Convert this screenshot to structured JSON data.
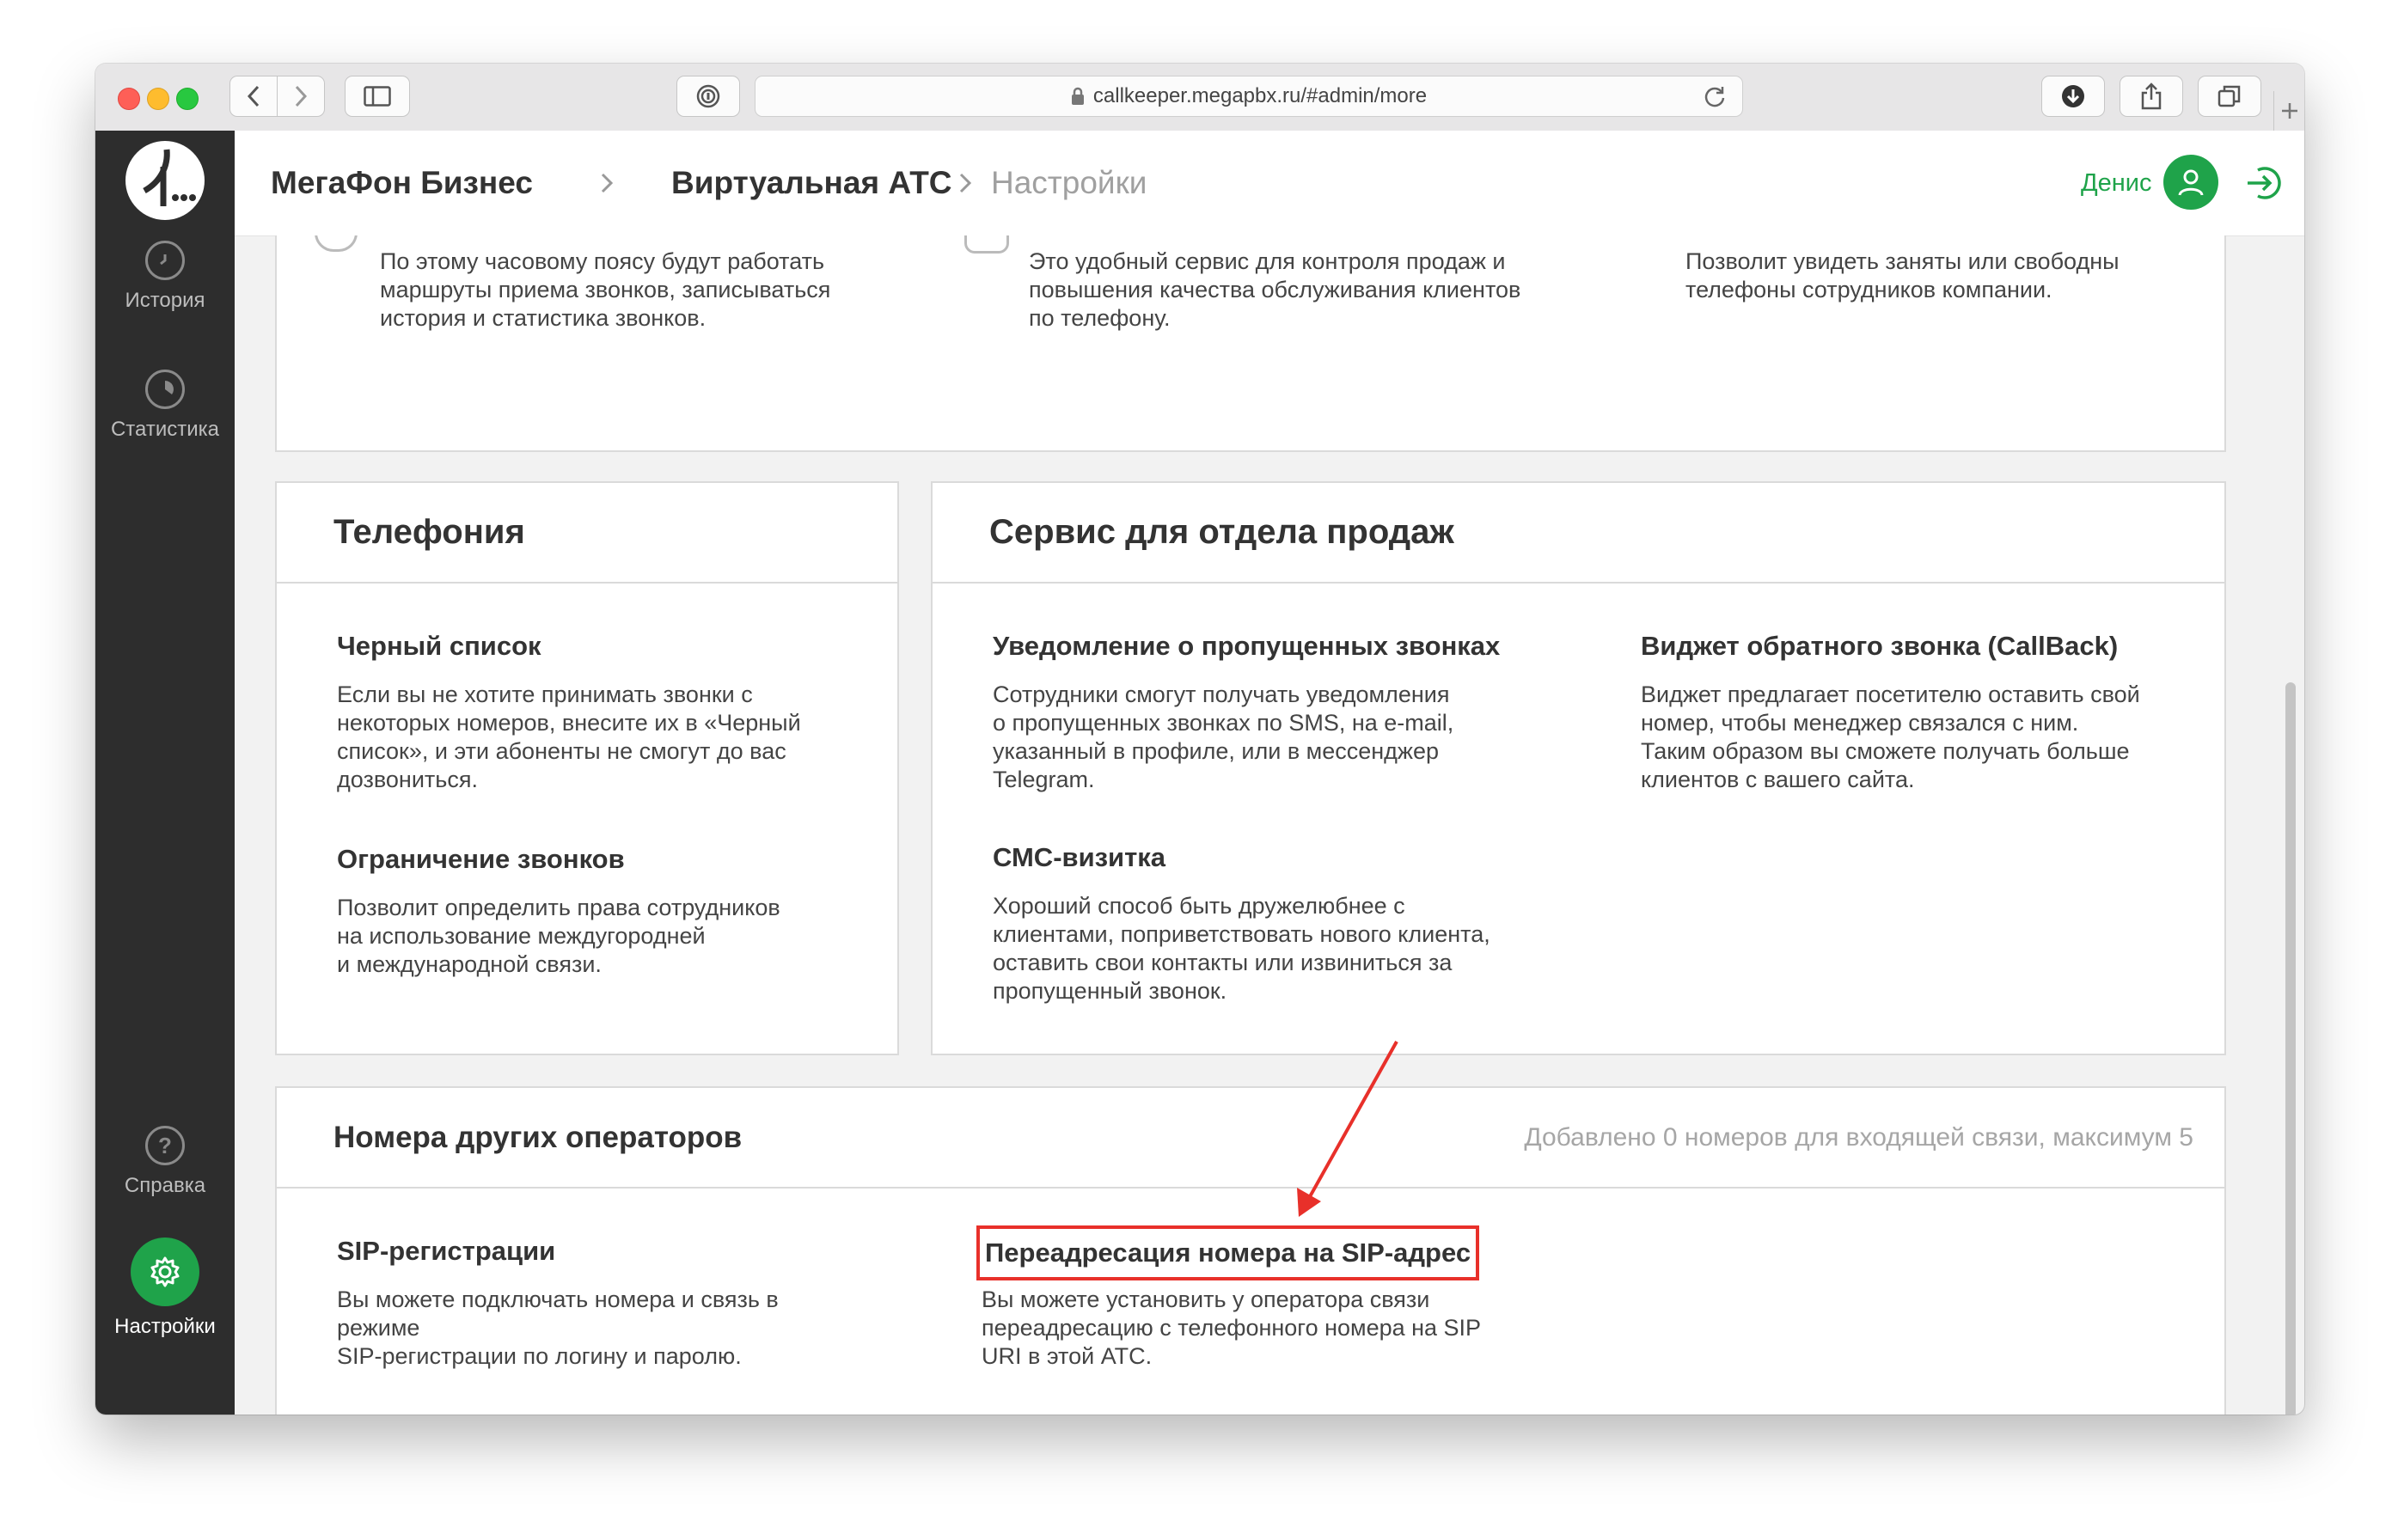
{
  "browser": {
    "url": "callkeeper.megapbx.ru/#admin/more"
  },
  "header": {
    "crumbs": [
      "МегаФон Бизнес",
      "Виртуальная АТС",
      "Настройки"
    ],
    "user_name": "Денис"
  },
  "sidebar": {
    "items": [
      {
        "label": "История",
        "icon": "clock-icon"
      },
      {
        "label": "Статистика",
        "icon": "pie-chart-icon"
      },
      {
        "label": "Справка",
        "icon": "help-icon"
      },
      {
        "label": "Настройки",
        "icon": "gear-icon",
        "active": true
      }
    ]
  },
  "top_card": {
    "col1_desc": "По этому часовому поясу будут работать\nмаршруты приема звонков, записываться\nистория и статистика звонков.",
    "col2_desc": "Это удобный сервис для контроля продаж и\nповышения качества обслуживания клиентов\nпо телефону.",
    "col3_desc": "Позволит увидеть заняты или свободны\nтелефоны сотрудников компании."
  },
  "telephony": {
    "title": "Телефония",
    "items": [
      {
        "title": "Черный список",
        "desc": "Если вы не хотите принимать звонки с\nнекоторых номеров, внесите их в «Черный\nсписок», и эти абоненты не смогут до вас\nдозвониться."
      },
      {
        "title": "Ограничение звонков",
        "desc": "Позволит определить права сотрудников\nна использование междугородней\nи международной связи."
      }
    ]
  },
  "sales": {
    "title": "Сервис для отдела продаж",
    "items": [
      {
        "title": "Уведомление о пропущенных звонках",
        "desc": "Сотрудники смогут получать уведомления\nо пропущенных звонках по SMS, на e-mail,\nуказанный в профиле, или в мессенджер\nTelegram."
      },
      {
        "title": "Виджет обратного звонка (CallBack)",
        "desc": "Виджет предлагает посетителю оставить свой\nномер, чтобы менеджер связался с ним.\nТаким образом вы сможете получать больше\nклиентов с вашего сайта."
      },
      {
        "title": "СМС-визитка",
        "desc": "Хороший способ быть дружелюбнее с\nклиентами, поприветствовать нового клиента,\nоставить свои контакты или извиниться за\nпропущенный звонок."
      }
    ]
  },
  "operators": {
    "title": "Номера других операторов",
    "status": "Добавлено 0 номеров для входящей связи, максимум 5",
    "items": [
      {
        "title": "SIP-регистрации",
        "desc": "Вы можете подключать номера и связь в\nрежиме\nSIP-регистрации по логину и паролю."
      },
      {
        "title": "Переадресация номера на SIP-адрес",
        "desc": "Вы можете установить у оператора связи\nпереадресацию с телефонного номера на SIP\nURI в этой АТС."
      }
    ]
  },
  "colors": {
    "brand_green": "#1fa34a",
    "annotation_red": "#e8302a"
  }
}
